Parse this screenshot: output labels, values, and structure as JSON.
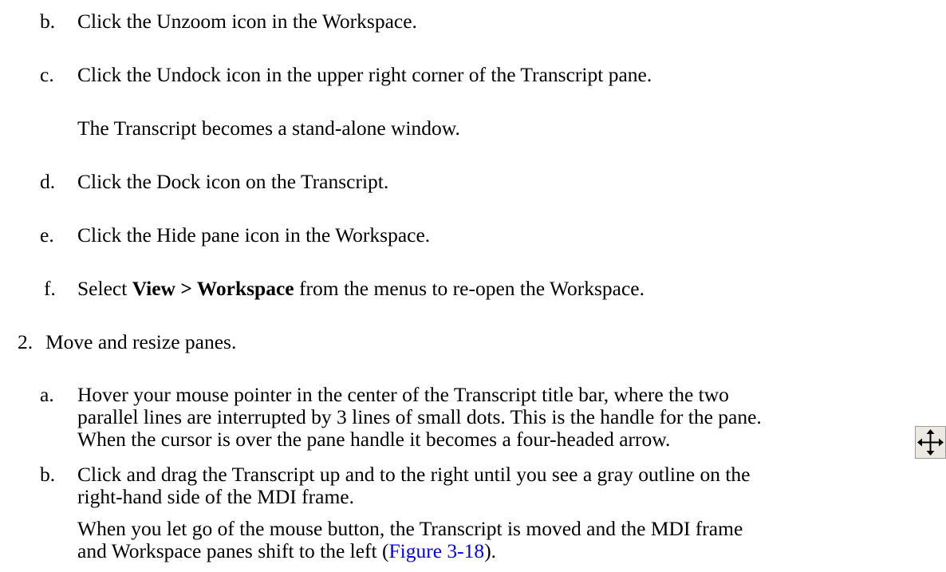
{
  "steps": {
    "b1": {
      "marker": "b.",
      "text": "Click the Unzoom icon in the Workspace."
    },
    "c1": {
      "marker": "c.",
      "text": "Click the Undock icon in the upper right corner of the Transcript pane.",
      "result": "The Transcript becomes a stand-alone window."
    },
    "d1": {
      "marker": "d.",
      "text": "Click the Dock icon on the Transcript."
    },
    "e1": {
      "marker": "e.",
      "text": "Click the Hide pane icon in the Workspace."
    },
    "f1": {
      "marker": "f.",
      "text_before": "Select ",
      "bold": "View > Workspace",
      "text_after": " from the menus to re-open the Workspace."
    },
    "step2": {
      "marker": "2.",
      "text": "Move and resize panes."
    },
    "a2": {
      "marker": "a.",
      "lines": [
        "Hover your mouse pointer in the center of the Transcript title bar, where the two",
        "parallel lines are interrupted by 3 lines of small dots. This is the handle for the pane.",
        "When the cursor is over the pane handle it becomes a four-headed arrow."
      ],
      "icon": "four-headed-arrow-icon"
    },
    "b2": {
      "marker": "b.",
      "lines": [
        "Click and drag the Transcript up and to the right until you see a gray outline on the",
        "right-hand side of the MDI frame."
      ],
      "result_lines": [
        "When you let go of the mouse button, the Transcript is moved and the MDI frame",
        "and Workspace panes shift to the left ("
      ],
      "link": "Figure 3-18",
      "result_end": ")."
    }
  },
  "colors": {
    "text": "#000000",
    "link": "#0000ee",
    "icon_background": "#ebe9e2"
  }
}
